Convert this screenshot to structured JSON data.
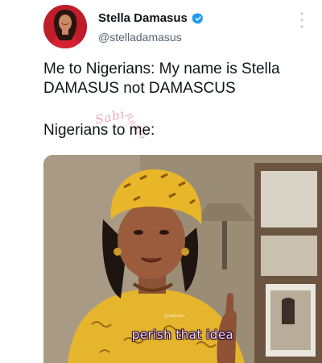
{
  "tweet": {
    "author": {
      "display_name": "Stella Damasus",
      "handle": "@stelladamasus",
      "verified": true
    },
    "text_line1": "Me to Nigerians: My name is Stella DAMASUS not DAMASCUS",
    "text_line2": "Nigerians to me:",
    "watermark": "Sabi",
    "watermark2": "Radio",
    "media": {
      "caption": "perish that idea",
      "small_watermark": "@sabiradio"
    }
  },
  "icons": {
    "verified": "verified-badge-icon",
    "more": "more-options-icon"
  },
  "colors": {
    "verified_blue": "#1d9bf0",
    "handle_gray": "#536471",
    "headwrap_yellow": "#e8b628",
    "caption_pink": "#f7d6f2"
  }
}
